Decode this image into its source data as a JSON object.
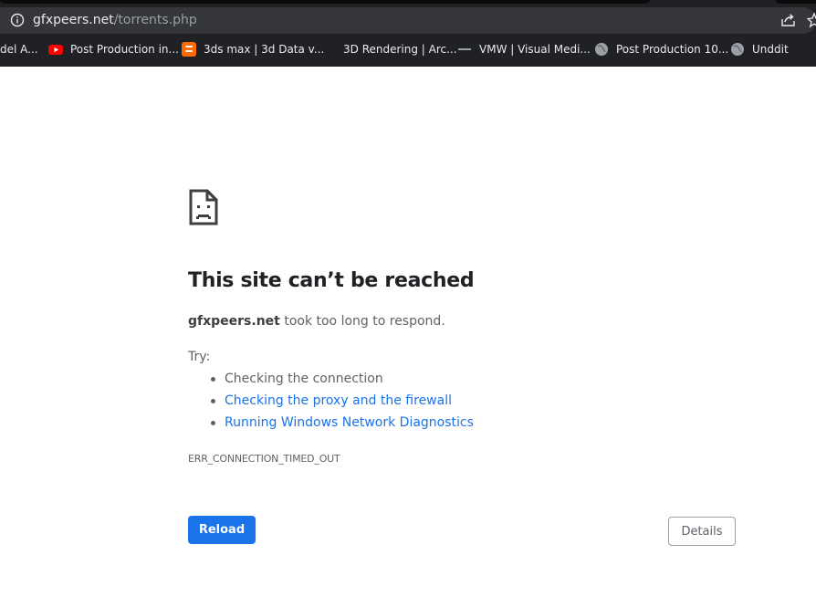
{
  "browser": {
    "url_host": "gfxpeers.net",
    "url_path": "/torrents.php",
    "bookmarks": [
      {
        "label": "del A...",
        "icon": "none"
      },
      {
        "label": "Post Production in...",
        "icon": "youtube-icon"
      },
      {
        "label": "3ds max | 3d Data v...",
        "icon": "blogger-icon"
      },
      {
        "label": "3D Rendering | Arc...",
        "icon": "none"
      },
      {
        "label": "VMW | Visual Medi...",
        "icon": "vmw-icon"
      },
      {
        "label": "Post Production 10...",
        "icon": "globe-icon"
      },
      {
        "label": "Unddit",
        "icon": "globe-icon"
      }
    ]
  },
  "error_page": {
    "icon": "sad-page-icon",
    "title": "This site can’t be reached",
    "host": "gfxpeers.net",
    "message_suffix": " took too long to respond.",
    "try_label": "Try:",
    "suggestions": [
      "Checking the connection",
      "Checking the proxy and the firewall",
      "Running Windows Network Diagnostics"
    ],
    "error_code": "ERR_CONNECTION_TIMED_OUT",
    "reload_label": "Reload",
    "details_label": "Details"
  },
  "colors": {
    "accent": "#1a73e8",
    "toolbar": "#202124",
    "omnibox": "#35363a",
    "text_secondary": "#5f6368"
  }
}
